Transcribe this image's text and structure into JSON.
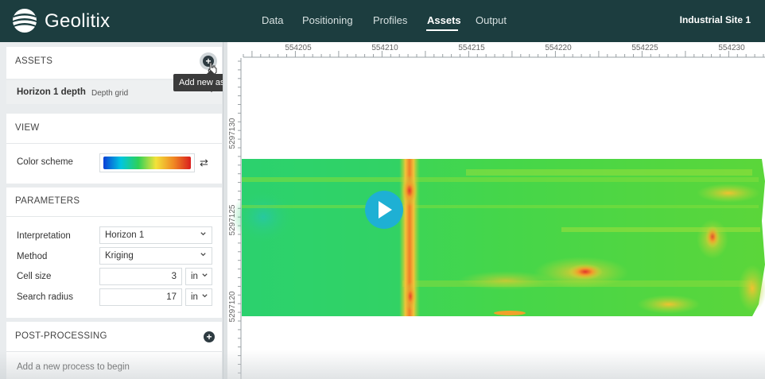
{
  "app": {
    "brand": "Geolitix",
    "site": "Industrial Site 1"
  },
  "nav": {
    "items": [
      {
        "label": "Data"
      },
      {
        "label": "Positioning"
      },
      {
        "label": "Profiles"
      },
      {
        "label": "Assets"
      },
      {
        "label": "Output"
      }
    ],
    "active": "Assets"
  },
  "assets": {
    "title": "ASSETS",
    "tooltip": "Add new asset",
    "item": {
      "name": "Horizon 1 depth",
      "type": "Depth grid"
    }
  },
  "view": {
    "title": "VIEW",
    "color_scheme_label": "Color scheme"
  },
  "parameters": {
    "title": "PARAMETERS",
    "interpretation_label": "Interpretation",
    "interpretation_value": "Horizon 1",
    "method_label": "Method",
    "method_value": "Kriging",
    "cell_size_label": "Cell size",
    "cell_size_value": "3",
    "cell_size_unit": "in",
    "search_radius_label": "Search radius",
    "search_radius_value": "17",
    "search_radius_unit": "in"
  },
  "post_processing": {
    "title": "POST-PROCESSING",
    "empty_text": "Add a new process to begin"
  },
  "map": {
    "x_ticks": [
      "554205",
      "554210",
      "554215",
      "554220",
      "554225",
      "554230"
    ],
    "y_ticks": [
      "5297130",
      "5297125",
      "5297120"
    ]
  },
  "colors": {
    "header_bg": "#1c3d3f",
    "play_button": "#1eb0d4",
    "scheme": [
      "#0a3fd6",
      "#00c6e0",
      "#2ed158",
      "#f2e23a",
      "#f08a24",
      "#d91e1e"
    ]
  }
}
